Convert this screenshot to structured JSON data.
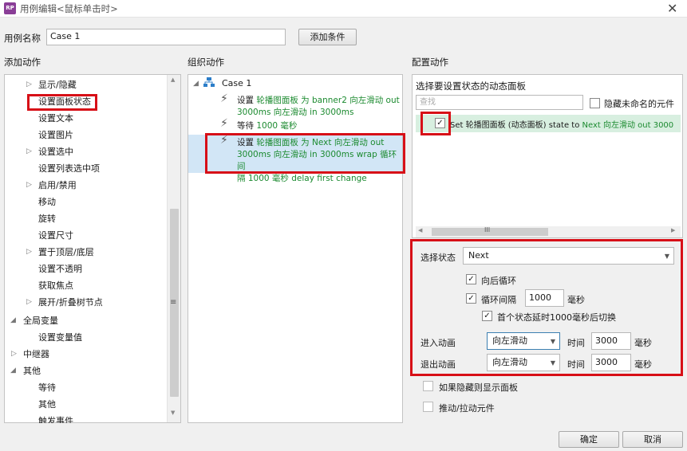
{
  "window": {
    "app_icon": "RP",
    "title": "用例编辑<鼠标单击时>",
    "close": "✕"
  },
  "case": {
    "label": "用例名称",
    "value": "Case 1",
    "add_condition": "添加条件"
  },
  "left": {
    "header": "添加动作",
    "items": [
      {
        "label": "显示/隐藏",
        "arrow": "▷"
      },
      {
        "label": "设置面板状态",
        "arrow": ""
      },
      {
        "label": "设置文本",
        "arrow": ""
      },
      {
        "label": "设置图片",
        "arrow": ""
      },
      {
        "label": "设置选中",
        "arrow": "▷"
      },
      {
        "label": "设置列表选中项",
        "arrow": ""
      },
      {
        "label": "启用/禁用",
        "arrow": "▷"
      },
      {
        "label": "移动",
        "arrow": ""
      },
      {
        "label": "旋转",
        "arrow": ""
      },
      {
        "label": "设置尺寸",
        "arrow": ""
      },
      {
        "label": "置于顶层/底层",
        "arrow": "▷"
      },
      {
        "label": "设置不透明",
        "arrow": ""
      },
      {
        "label": "获取焦点",
        "arrow": ""
      },
      {
        "label": "展开/折叠树节点",
        "arrow": "▷"
      }
    ],
    "group1": "全局变量",
    "group1_child": "设置变量值",
    "group2": "中继器",
    "group3": "其他",
    "group3_children": [
      "等待",
      "其他",
      "触发事件"
    ],
    "arrow_open": "◢",
    "arrow_closed": "▷",
    "scroll_grip": "≡",
    "scroll_up": "▲",
    "scroll_down": "▼"
  },
  "middle": {
    "header": "组织动作",
    "case_name": "Case 1",
    "tree_arrow": "◢",
    "bolt": "⚡",
    "a1_lead": "设置 ",
    "a1_l1": "轮播图面板 为 banner2 向左滑动 out",
    "a1_l2": "3000ms 向左滑动 in 3000ms",
    "a2_lead": "等待 ",
    "a2_green": "1000 毫秒",
    "a3_lead": "设置 ",
    "a3_l1": "轮播图面板 为 Next 向左滑动 out",
    "a3_l2": "3000ms 向左滑动 in 3000ms wrap 循环间",
    "a3_l3": "隔 1000 毫秒 delay first change"
  },
  "right": {
    "header": "配置动作",
    "sub_header": "选择要设置状态的动态面板",
    "search_placeholder": "查找",
    "hide_unnamed": "隐藏未命名的元件",
    "item_lead": "Set 轮播图面板 (动态面板) state to ",
    "item_green": "Next 向左滑动 out 3000",
    "hscroll_left": "◀",
    "hscroll_right": "▶",
    "hscroll_grip": "III",
    "check": "✓",
    "state_label": "选择状态",
    "state_value": "Next",
    "wrap": "向后循环",
    "interval_label": "循环间隔",
    "interval_value": "1000",
    "ms": "毫秒",
    "delay_first": "首个状态延时1000毫秒后切换",
    "enter_label": "进入动画",
    "enter_value": "向左滑动",
    "exit_label": "退出动画",
    "exit_value": "向左滑动",
    "time_label": "时间",
    "enter_time": "3000",
    "exit_time": "3000",
    "show_hidden": "如果隐藏则显示面板",
    "push_pull": "推动/拉动元件",
    "dd_arrow": "▼"
  },
  "footer": {
    "ok": "确定",
    "cancel": "取消"
  }
}
